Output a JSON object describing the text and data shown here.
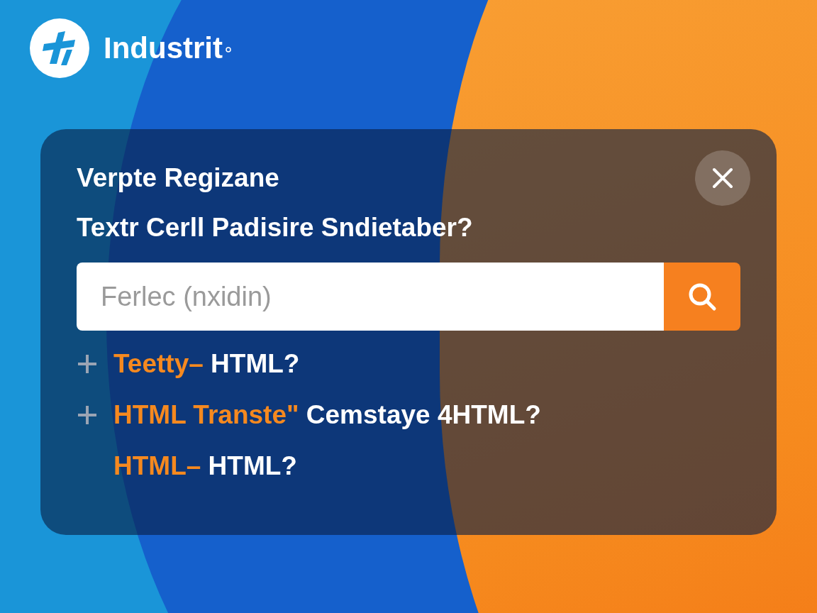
{
  "brand": {
    "name": "Industrit"
  },
  "dialog": {
    "title": "Verpte Regizane",
    "question": "Textr Cerll Padisire Sndietaber?",
    "search": {
      "placeholder": "Ferlec (nxidin)"
    },
    "suggestions": [
      {
        "expandable": true,
        "highlight": "Teetty–",
        "rest": "HTML?"
      },
      {
        "expandable": true,
        "highlight": "HTML Transte\"",
        "rest": "Cemstaye 4HTML?"
      },
      {
        "expandable": false,
        "highlight": "HTML–",
        "rest": "HTML?"
      }
    ]
  }
}
